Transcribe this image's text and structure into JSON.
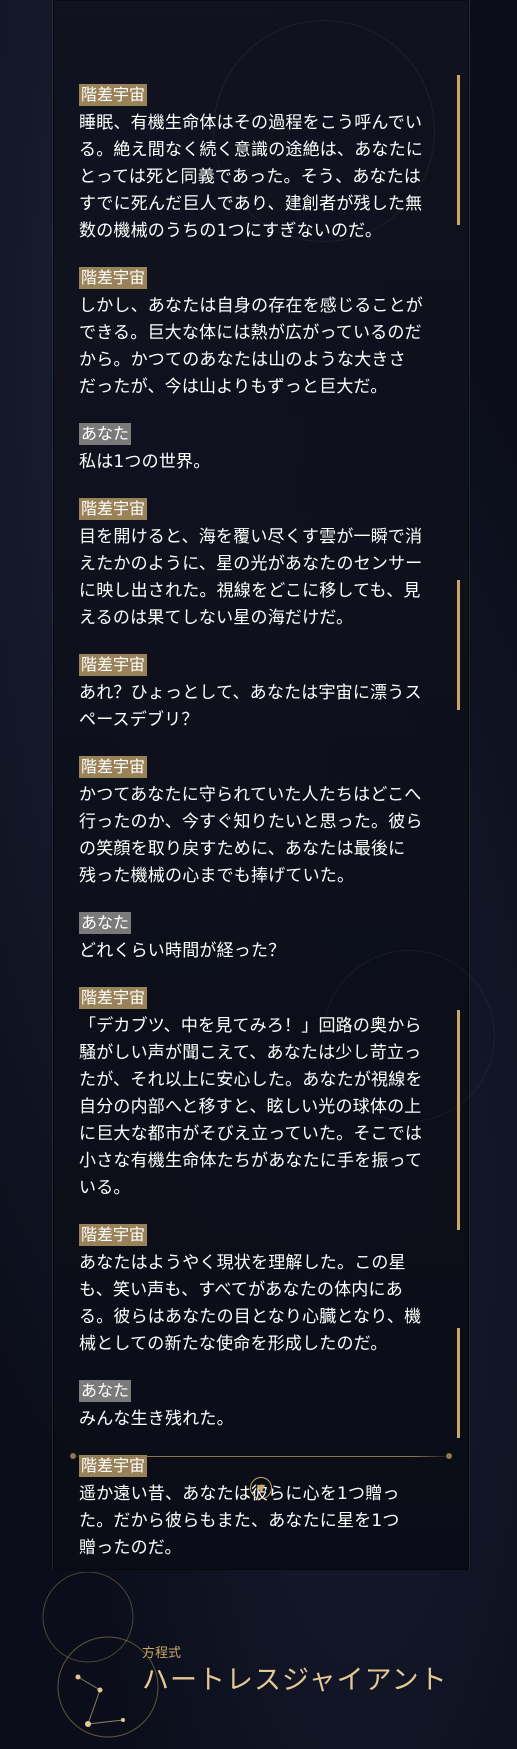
{
  "dialogue": [
    {
      "speaker": "階差宇宙",
      "type": "gold",
      "lines": [
        "睡眠、有機生命体はその過程をこう呼んでい",
        "る。絶え間なく続く意識の途絶は、あなたに",
        "とっては死と同義であった。そう、あなたは",
        "すでに死んだ巨人であり、建創者が残した無",
        "数の機械のうちの1つにすぎないのだ。"
      ]
    },
    {
      "speaker": "階差宇宙",
      "type": "gold",
      "lines": [
        "しかし、あなたは自身の存在を感じることが",
        "できる。巨大な体には熱が広がっているのだ",
        "から。かつてのあなたは山のような大きさ",
        "だったが、今は山よりもずっと巨大だ。"
      ]
    },
    {
      "speaker": "あなた",
      "type": "gray",
      "lines": [
        "私は1つの世界。"
      ]
    },
    {
      "speaker": "階差宇宙",
      "type": "gold",
      "lines": [
        "目を開けると、海を覆い尽くす雲が一瞬で消",
        "えたかのように、星の光があなたのセンサー",
        "に映し出された。視線をどこに移しても、見",
        "えるのは果てしない星の海だけだ。"
      ]
    },
    {
      "speaker": "階差宇宙",
      "type": "gold",
      "lines": [
        "あれ？ひょっとして、あなたは宇宙に漂うス",
        "ペースデブリ？"
      ]
    },
    {
      "speaker": "階差宇宙",
      "type": "gold",
      "lines": [
        "かつてあなたに守られていた人たちはどこへ",
        "行ったのか、今すぐ知りたいと思った。彼ら",
        "の笑顔を取り戻すために、あなたは最後に",
        "残った機械の心までも捧げていた。"
      ]
    },
    {
      "speaker": "あなた",
      "type": "gray",
      "lines": [
        "どれくらい時間が経った？"
      ]
    },
    {
      "speaker": "階差宇宙",
      "type": "gold",
      "lines": [
        "「デカブツ、中を見てみろ！」回路の奥から",
        "騒がしい声が聞こえて、あなたは少し苛立っ",
        "たが、それ以上に安心した。あなたが視線を",
        "自分の内部へと移すと、眩しい光の球体の上",
        "に巨大な都市がそびえ立っていた。そこでは",
        "小さな有機生命体たちがあなたに手を振って",
        "いる。"
      ]
    },
    {
      "speaker": "階差宇宙",
      "type": "gold",
      "lines": [
        "あなたはようやく現状を理解した。この星",
        "も、笑い声も、すべてがあなたの体内にあ",
        "る。彼らはあなたの目となり心臓となり、機",
        "械としての新たな使命を形成したのだ。"
      ]
    },
    {
      "speaker": "あなた",
      "type": "gray",
      "lines": [
        "みんな生き残れた。"
      ]
    },
    {
      "speaker": "階差宇宙",
      "type": "gold",
      "lines": [
        "遥か遠い昔、あなたは彼らに心を1つ贈っ",
        "た。だから彼らもまた、あなたに星を1つ",
        "贈ったのだ。"
      ]
    }
  ],
  "footer": {
    "subtitle": "方程式",
    "title": "ハートレスジャイアント",
    "more_icon": "chevron-down-icon"
  },
  "colors": {
    "speaker_gold": "#9a8258",
    "speaker_gray": "#7a7a7a",
    "accent": "#c9a866"
  }
}
